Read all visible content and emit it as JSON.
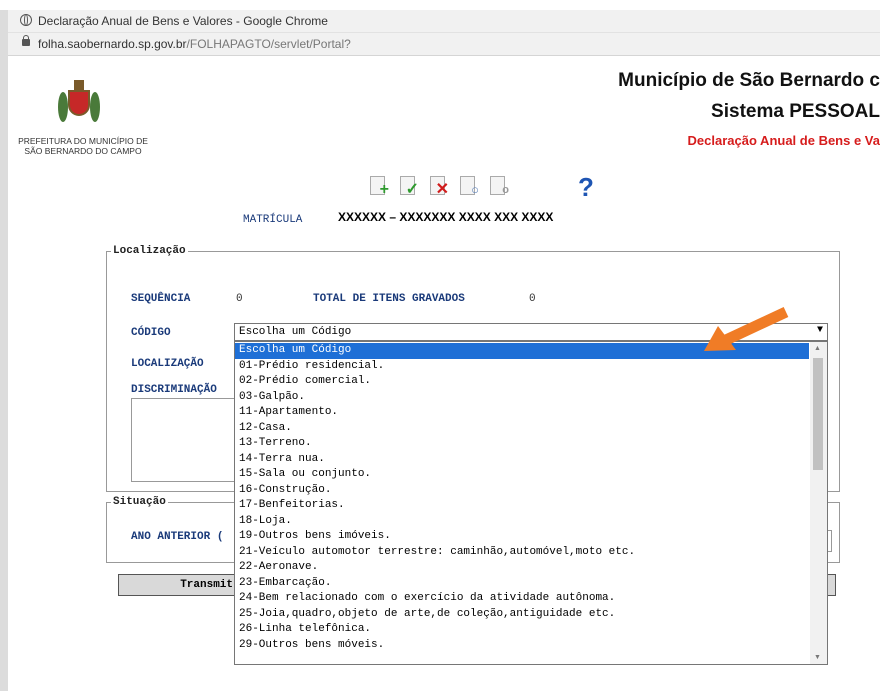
{
  "browser": {
    "window_title": "Declaração Anual de Bens e Valores - Google Chrome",
    "url_domain": "folha.saobernardo.sp.gov.br",
    "url_path": "/FOLHAPAGTO/servlet/Portal?"
  },
  "header": {
    "logo_text_line1": "PREFEITURA DO MUNICÍPIO DE",
    "logo_text_line2": "SÃO BERNARDO DO CAMPO",
    "title": "Município de São Bernardo c",
    "subtitle": "Sistema PESSOAL",
    "red_title": "Declaração Anual de Bens e Va"
  },
  "toolbar": {
    "icons": [
      "add-icon",
      "confirm-icon",
      "delete-icon",
      "search-icon",
      "clear-icon",
      "help-icon"
    ],
    "help_glyph": "?"
  },
  "matricula": {
    "label": "MATRÍCULA",
    "value": "XXXXXX – XXXXXXX XXXX XXX XXXX"
  },
  "localizacao": {
    "legend": "Localização",
    "sequencia_label": "SEQUÊNCIA",
    "sequencia_value": "0",
    "total_label": "TOTAL DE ITENS GRAVADOS",
    "total_value": "0",
    "codigo_label": "CÓDIGO",
    "codigo_selected": "Escolha um Código",
    "localizacao_label": "LOCALIZAÇÃO",
    "discriminacao_label": "DISCRIMINAÇÃO"
  },
  "situacao": {
    "legend": "Situação",
    "ano_anterior_label": "ANO ANTERIOR (",
    "transmit_label": "Transmit"
  },
  "dropdown": {
    "options": [
      "Escolha um Código",
      "01-Prédio residencial.",
      "02-Prédio comercial.",
      "03-Galpão.",
      "11-Apartamento.",
      "12-Casa.",
      "13-Terreno.",
      "14-Terra nua.",
      "15-Sala ou conjunto.",
      "16-Construção.",
      "17-Benfeitorias.",
      "18-Loja.",
      "19-Outros bens imóveis.",
      "21-Veículo automotor terrestre: caminhão,automóvel,moto etc.",
      "22-Aeronave.",
      "23-Embarcação.",
      "24-Bem relacionado com o exercício da atividade autônoma.",
      "25-Joia,quadro,objeto de arte,de coleção,antiguidade etc.",
      "26-Linha telefônica.",
      "29-Outros bens móveis."
    ],
    "highlighted_index": 0
  },
  "colors": {
    "highlight": "#1e6fd6",
    "arrow": "#f07c26",
    "header_red": "#d61c1c",
    "label_blue": "#1a3a7a"
  }
}
